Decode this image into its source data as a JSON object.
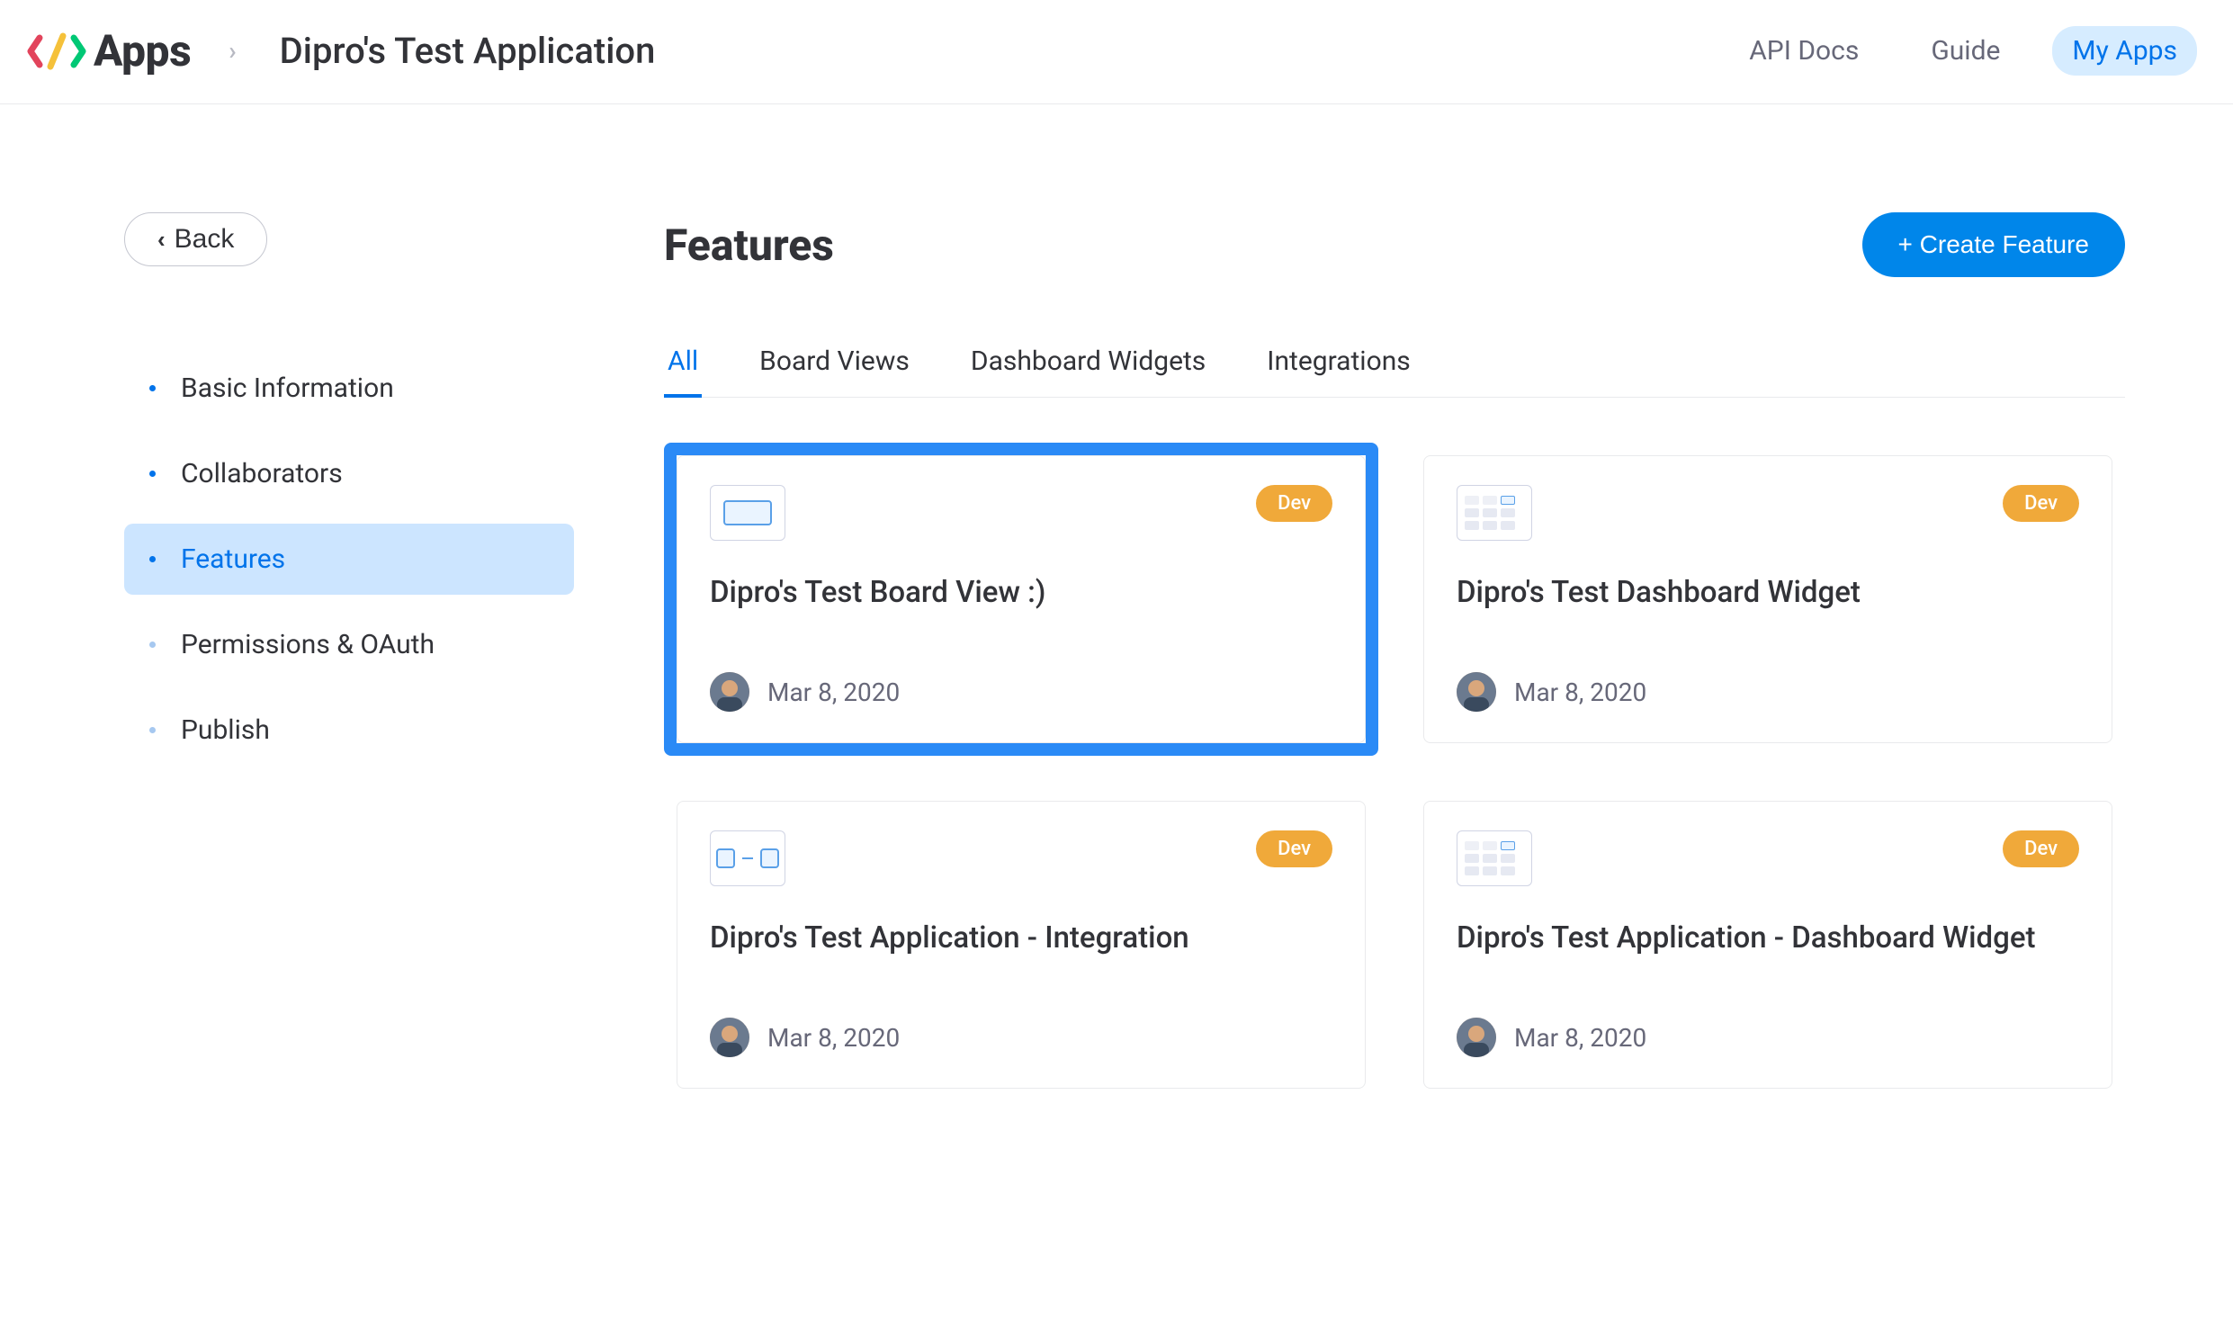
{
  "header": {
    "brand": "Apps",
    "breadcrumb": "Dipro's Test Application",
    "nav": [
      {
        "label": "API Docs",
        "active": false
      },
      {
        "label": "Guide",
        "active": false
      },
      {
        "label": "My Apps",
        "active": true
      }
    ]
  },
  "sidebar": {
    "back_label": "Back",
    "items": [
      {
        "label": "Basic Information",
        "active": false
      },
      {
        "label": "Collaborators",
        "active": false
      },
      {
        "label": "Features",
        "active": true
      },
      {
        "label": "Permissions & OAuth",
        "active": false
      },
      {
        "label": "Publish",
        "active": false
      }
    ]
  },
  "main": {
    "title": "Features",
    "create_label": "+ Create Feature",
    "tabs": [
      {
        "label": "All",
        "active": true
      },
      {
        "label": "Board Views",
        "active": false
      },
      {
        "label": "Dashboard Widgets",
        "active": false
      },
      {
        "label": "Integrations",
        "active": false
      }
    ],
    "cards": [
      {
        "icon": "board-view",
        "badge": "Dev",
        "title": "Dipro's Test Board View :)",
        "date": "Mar 8, 2020",
        "highlight": true
      },
      {
        "icon": "dashboard-widget",
        "badge": "Dev",
        "title": "Dipro's Test Dashboard Widget",
        "date": "Mar 8, 2020",
        "highlight": false
      },
      {
        "icon": "integration",
        "badge": "Dev",
        "title": "Dipro's Test Application - Integration",
        "date": "Mar 8, 2020",
        "highlight": false
      },
      {
        "icon": "dashboard-widget",
        "badge": "Dev",
        "title": "Dipro's Test Application - Dashboard Widget",
        "date": "Mar 8, 2020",
        "highlight": false
      }
    ]
  }
}
